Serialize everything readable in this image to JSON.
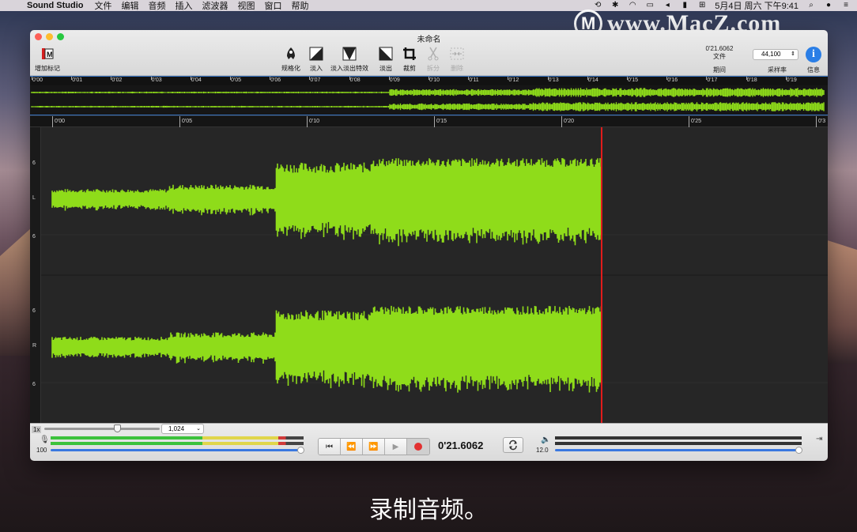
{
  "menubar": {
    "app_name": "Sound Studio",
    "menus": [
      "文件",
      "编辑",
      "音频",
      "插入",
      "滤波器",
      "视图",
      "窗口",
      "帮助"
    ],
    "datetime": "5月4日 周六 下午9:41"
  },
  "watermark": {
    "text": "www.MacZ.com"
  },
  "window": {
    "title": "未命名"
  },
  "toolbar": {
    "add_marker": "增加标记",
    "normalize": "规格化",
    "fade_in": "淡入",
    "fade_in_out": "淡入淡出特效",
    "fade_out": "淡出",
    "crop": "裁剪",
    "split": "拆分",
    "delete": "删除",
    "duration_value": "0'21.6062",
    "duration_unit": "文件",
    "duration_label": "期间",
    "sample_rate_value": "44,100",
    "sample_rate_label": "采样率",
    "info_label": "信息"
  },
  "overview_ticks": [
    "0'00",
    "0'01",
    "0'02",
    "0'03",
    "0'04",
    "0'05",
    "0'06",
    "0'07",
    "0'08",
    "0'09",
    "0'10",
    "0'11",
    "0'12",
    "0'13",
    "0'14",
    "0'15",
    "0'16",
    "0'17",
    "0'18",
    "0'19"
  ],
  "main_ticks": [
    "0'00",
    "0'05",
    "0'10",
    "0'15",
    "0'20",
    "0'25",
    "0'3"
  ],
  "channels": {
    "left": {
      "label": "L",
      "top_scale": "6",
      "bottom_scale": "6"
    },
    "right": {
      "label": "R",
      "top_scale": "6",
      "bottom_scale": "6"
    }
  },
  "waveform_color": "#8fdc1a",
  "playhead_color": "#e01c1c",
  "transport": {
    "zoom_label": "1x",
    "block_size": "1,024",
    "input_volume": "100",
    "output_volume": "12.0",
    "time": "0'21.6062",
    "playhead_seconds": 21.6
  },
  "subtitle": "录制音频。"
}
